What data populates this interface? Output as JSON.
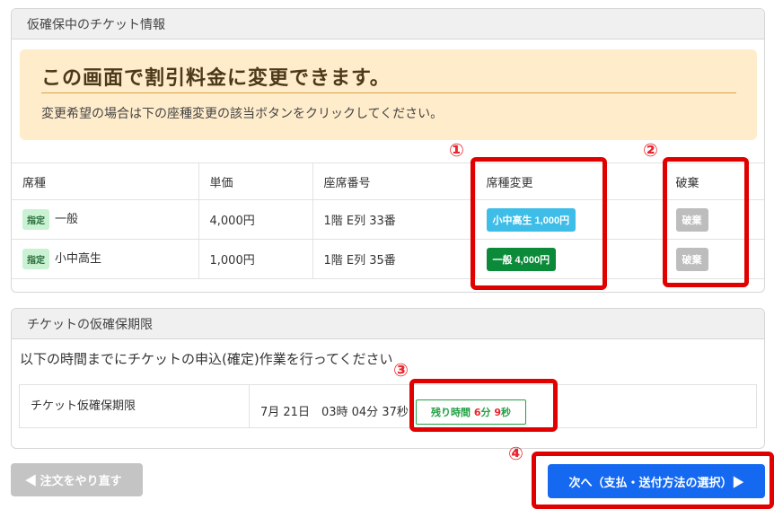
{
  "panel1": {
    "title": "仮確保中のチケット情報",
    "notice": {
      "title": "この画面で割引料金に変更できます。",
      "text": "変更希望の場合は下の座種変更の該当ボタンをクリックしてください。"
    },
    "table": {
      "headers": [
        "席種",
        "単価",
        "座席番号",
        "席種変更",
        "破棄"
      ],
      "rows": [
        {
          "badge": "指定",
          "seat_type": "一般",
          "price": "4,000円",
          "seat_no": "1階 E列 33番",
          "change_label": "小中高生 1,000円",
          "discard_label": "破棄"
        },
        {
          "badge": "指定",
          "seat_type": "小中高生",
          "price": "1,000円",
          "seat_no": "1階 E列 35番",
          "change_label": "一般 4,000円",
          "discard_label": "破棄"
        }
      ]
    }
  },
  "panel2": {
    "title": "チケットの仮確保期限",
    "text": "以下の時間までにチケットの申込(確定)作業を行ってください",
    "label": "チケット仮確保期限",
    "deadline": "7月 21日　03時 04分 37秒",
    "remaining": {
      "prefix": "残り時間 ",
      "minutes": "6",
      "min_unit": "分 ",
      "seconds": "9",
      "sec_unit": "秒"
    }
  },
  "footer": {
    "back_label": "◀ 注文をやり直す",
    "next_label": "次へ（支払・送付方法の選択）▶"
  },
  "annotations": [
    "①",
    "②",
    "③",
    "④"
  ],
  "colors": {
    "annotation_red": "#e00000",
    "primary_blue": "#1469f0",
    "notice_bg": "#ffeccb",
    "green": "#0b8a3a",
    "light_blue": "#3dbde7"
  }
}
